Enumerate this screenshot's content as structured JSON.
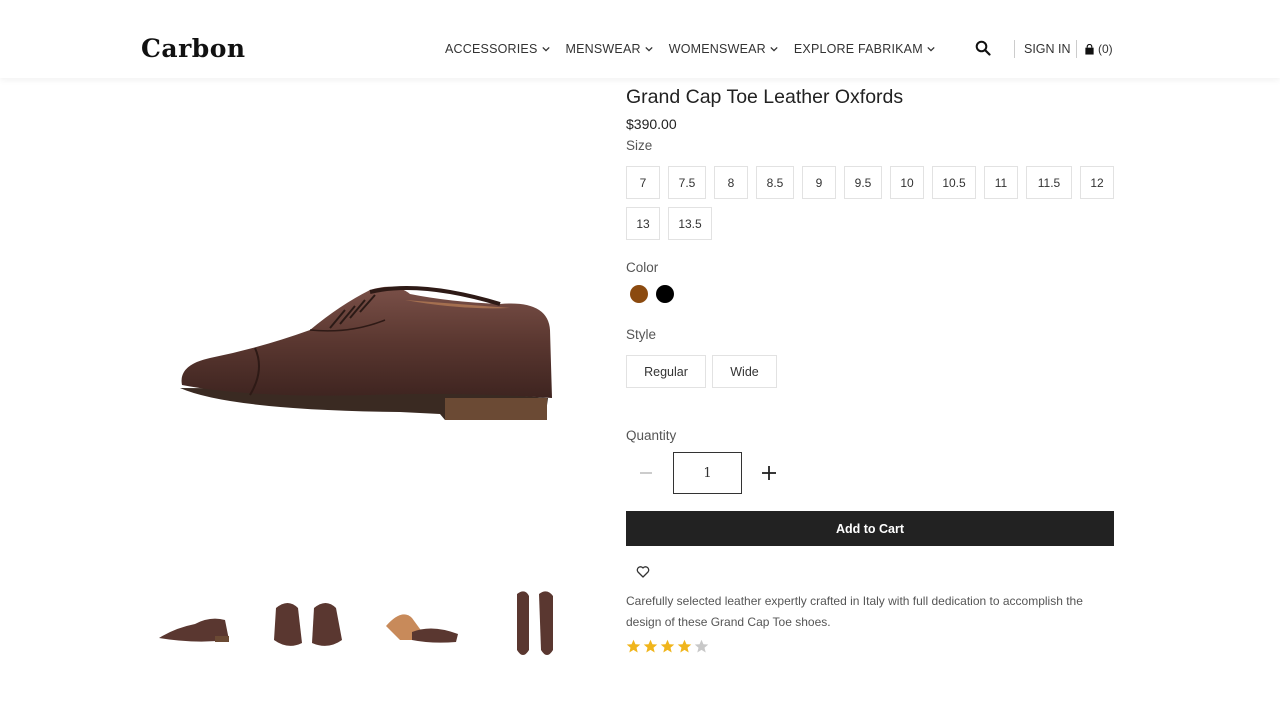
{
  "header": {
    "logo": "Carbon",
    "nav": [
      {
        "label": "ACCESSORIES"
      },
      {
        "label": "MENSWEAR"
      },
      {
        "label": "WOMENSWEAR"
      },
      {
        "label": "EXPLORE FABRIKAM"
      }
    ],
    "search_icon": "search-icon",
    "sign_in": "SIGN IN",
    "cart_count": "(0)",
    "cart_icon": "shopping-bag-icon"
  },
  "product": {
    "title": "Grand Cap Toe Leather Oxfords",
    "price": "$390.00",
    "size_label": "Size",
    "sizes": [
      "7",
      "7.5",
      "8",
      "8.5",
      "9",
      "9.5",
      "10",
      "10.5",
      "11",
      "11.5",
      "12",
      "13",
      "13.5"
    ],
    "color_label": "Color",
    "colors": [
      {
        "name": "brown",
        "hex": "#8b4a0f"
      },
      {
        "name": "black",
        "hex": "#000000"
      }
    ],
    "style_label": "Style",
    "styles": [
      "Regular",
      "Wide"
    ],
    "quantity_label": "Quantity",
    "quantity": "1",
    "add_to_cart": "Add to Cart",
    "wishlist_icon": "heart-icon",
    "description": "Carefully selected leather expertly crafted in Italy with full dedication to accomplish the design of these Grand Cap Toe shoes.",
    "rating": 4,
    "rating_max": 5,
    "star_color": "#f0b51c",
    "star_empty_color": "#c8c8c8",
    "shoe_color": "#5a3730"
  }
}
